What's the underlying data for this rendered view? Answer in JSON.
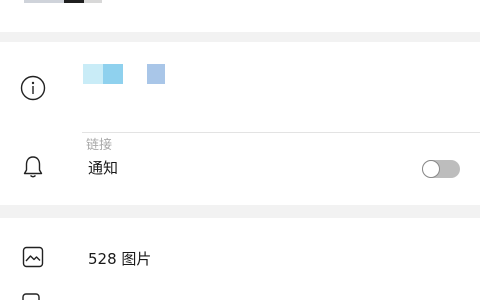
{
  "info_card": {
    "link": {
      "icon": "info-circle-icon",
      "subtitle": "链接"
    },
    "notify": {
      "icon": "bell-icon",
      "label": "通知",
      "toggle_on": false
    }
  },
  "media_card": {
    "photos": {
      "icon": "image-icon",
      "label": "528 图片"
    },
    "next_row_icon": "file-icon"
  },
  "colors": {
    "background": "#f2f2f2",
    "card": "#ffffff",
    "muted_text": "#a9a9a9",
    "toggle_off": "#bdbdbd"
  }
}
